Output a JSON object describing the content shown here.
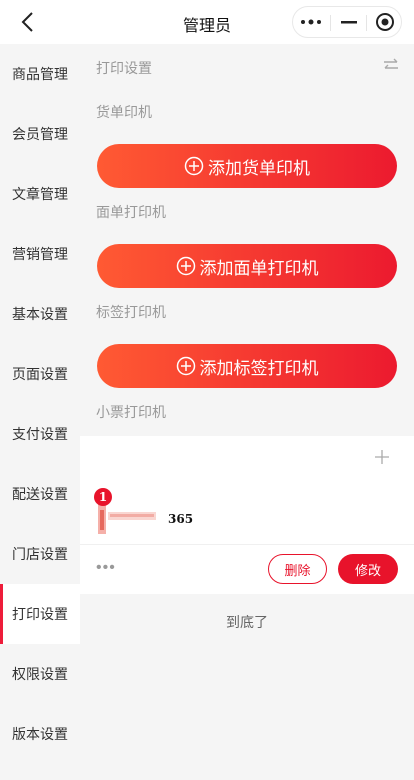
{
  "header": {
    "title": "管理员",
    "back_icon": "chevron-left-icon",
    "more_icon": "more-dots-icon",
    "minimize_icon": "minimize-icon",
    "close_icon": "target-close-icon"
  },
  "sidebar": {
    "items": [
      {
        "label": "商品管理"
      },
      {
        "label": "会员管理"
      },
      {
        "label": "文章管理"
      },
      {
        "label": "营销管理"
      },
      {
        "label": "基本设置"
      },
      {
        "label": "页面设置"
      },
      {
        "label": "支付设置"
      },
      {
        "label": "配送设置"
      },
      {
        "label": "门店设置"
      },
      {
        "label": "打印设置",
        "active": true
      },
      {
        "label": "权限设置"
      },
      {
        "label": "版本设置"
      }
    ]
  },
  "main": {
    "section_title": "打印设置",
    "invoice_printer": {
      "label": "货单印机",
      "button": "添加货单印机"
    },
    "waybill_printer": {
      "label": "面单打印机",
      "button": "添加面单打印机"
    },
    "tag_printer": {
      "label": "标签打印机",
      "button": "添加标签打印机"
    },
    "receipt_printer": {
      "label": "小票打印机",
      "printers": [
        {
          "index": "1",
          "name": "365",
          "more": "•••",
          "delete_label": "删除",
          "edit_label": "修改"
        }
      ]
    },
    "end_text": "到底了"
  },
  "colors": {
    "accent": "#e8132b",
    "gradient_start": "#ff5a33",
    "gradient_end": "#ec1a2f"
  }
}
